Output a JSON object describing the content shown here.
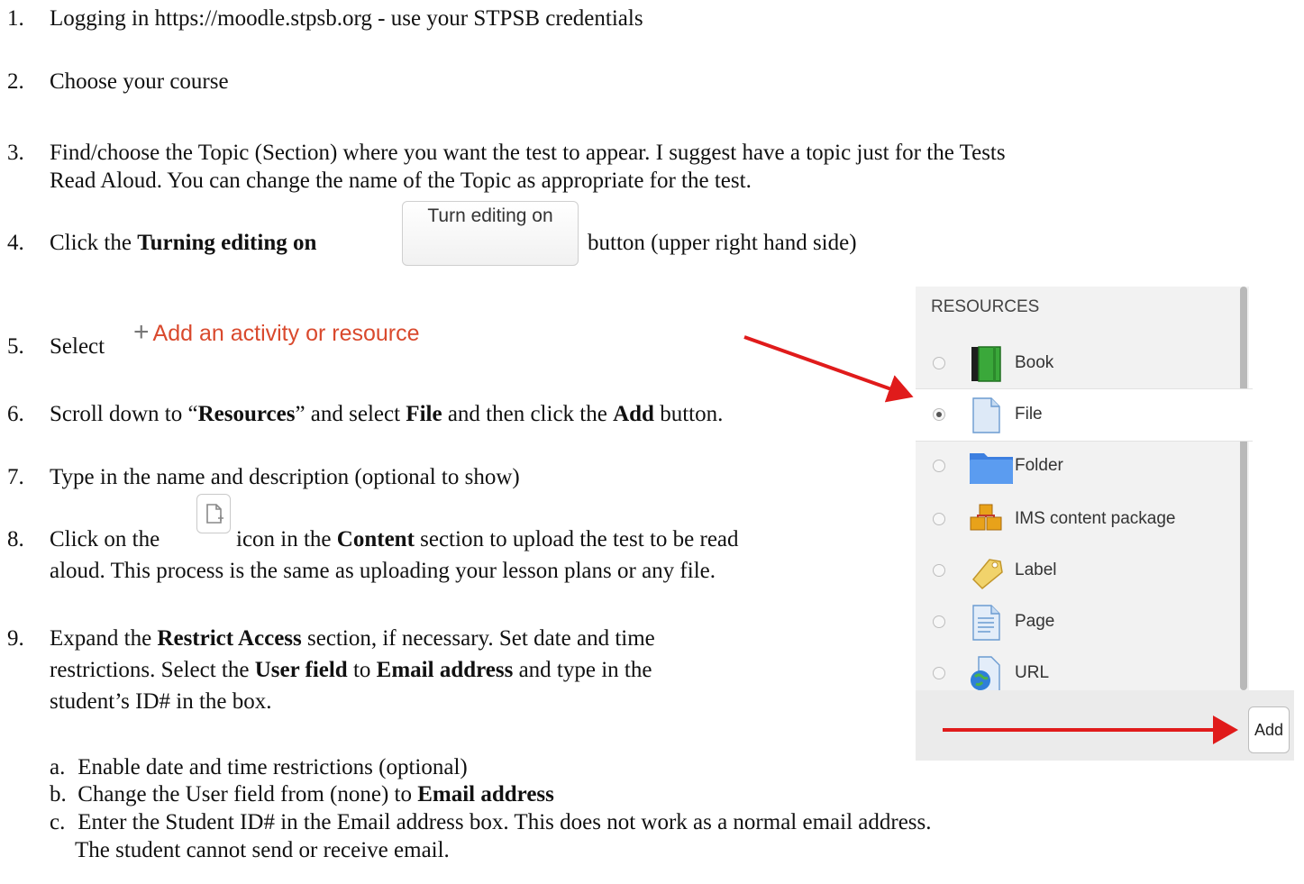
{
  "steps": {
    "s1": {
      "num": "1.",
      "text": "Logging in https://moodle.stpsb.org - use your STPSB credentials"
    },
    "s2": {
      "num": "2.",
      "text": "Choose your course"
    },
    "s3": {
      "num": "3.",
      "line1": "Find/choose the Topic (Section) where you want the test to appear.  I suggest have a topic just for the Tests",
      "line2": "Read Aloud.  You can change the name of the Topic as appropriate for the test."
    },
    "s4": {
      "num": "4.",
      "pre": "Click the ",
      "bold": "Turning editing on",
      "post": "button (upper right hand side)",
      "button_label": "Turn editing on"
    },
    "s5": {
      "num": "5.",
      "pre": "Select",
      "link": "Add an activity or resource"
    },
    "s6": {
      "num": "6.",
      "pre": "Scroll down to “",
      "b1": "Resources",
      "mid1": "” and select ",
      "b2": "File",
      "mid2": " and then click the ",
      "b3": "Add",
      "post": " button."
    },
    "s7": {
      "num": "7.",
      "text": "Type in the name and description (optional to show)"
    },
    "s8": {
      "num": "8.",
      "pre": "Click on the ",
      "mid": " icon in the ",
      "bold": "Content",
      "post": " section to upload the test to be read",
      "line2": "aloud.  This process is the same as uploading your lesson plans or any file."
    },
    "s9": {
      "num": "9.",
      "pre": "Expand the ",
      "b1": "Restrict Access",
      "post1": " section, if necessary.  Set date and time",
      "l2pre": "restrictions.  Select the ",
      "b2": "User field",
      "l2mid": " to ",
      "b3": "Email address",
      "l2post": " and type in the",
      "line3": "student’s ID# in the box."
    },
    "sa": {
      "num": "a.",
      "text": "Enable date and time restrictions (optional)"
    },
    "sb": {
      "num": "b.",
      "pre": "Change the User field from (none) to ",
      "bold": "Email address"
    },
    "sc": {
      "num": "c.",
      "line1": "Enter the Student ID# in the Email address box.  This does not work as a normal email address.",
      "line2": "The student cannot send or receive email."
    }
  },
  "resources_panel": {
    "heading": "RESOURCES",
    "items": [
      {
        "label": "Book",
        "icon": "book-icon",
        "selected": false
      },
      {
        "label": "File",
        "icon": "file-icon",
        "selected": true
      },
      {
        "label": "Folder",
        "icon": "folder-icon",
        "selected": false
      },
      {
        "label": "IMS content package",
        "icon": "package-icon",
        "selected": false
      },
      {
        "label": "Label",
        "icon": "label-tag-icon",
        "selected": false
      },
      {
        "label": "Page",
        "icon": "page-icon",
        "selected": false
      },
      {
        "label": "URL",
        "icon": "url-globe-icon",
        "selected": false
      }
    ],
    "add_label": "Add"
  },
  "colors": {
    "link": "#d9492d",
    "arrow": "#e01b1b"
  }
}
